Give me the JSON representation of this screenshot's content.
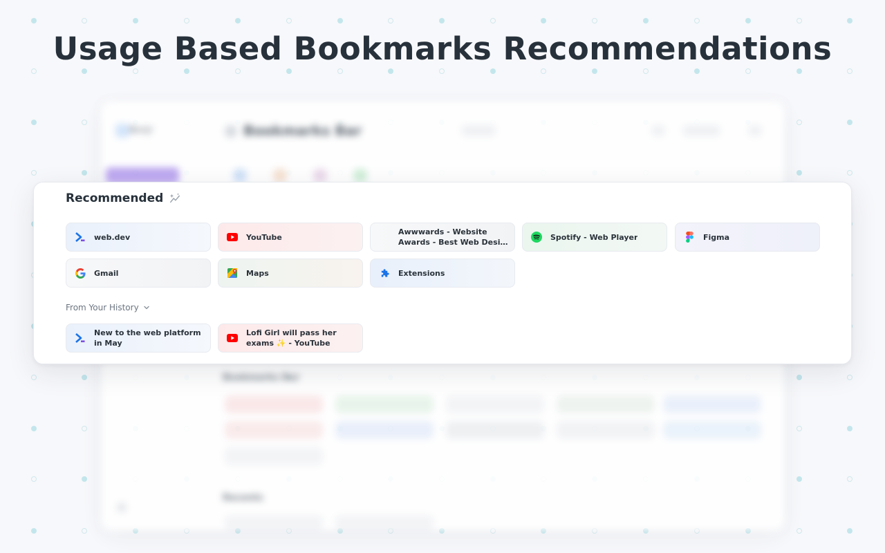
{
  "headline": "Usage Based Bookmarks Recommendations",
  "background_app": {
    "brand": "Bonjr",
    "title": "Bookmarks Bar",
    "section_label": "Bookmarks Bar",
    "section2_label": "Recents"
  },
  "recommended": {
    "title": "Recommended",
    "items": [
      {
        "label": "web.dev",
        "icon": "web-dev-icon"
      },
      {
        "label": "YouTube",
        "icon": "youtube-icon"
      },
      {
        "label": "Awwwards - Website Awards - Best Web Design Trends",
        "icon": "awwwards-icon"
      },
      {
        "label": "Spotify - Web Player",
        "icon": "spotify-icon"
      },
      {
        "label": "Figma",
        "icon": "figma-icon"
      },
      {
        "label": "Gmail",
        "icon": "google-icon"
      },
      {
        "label": "Maps",
        "icon": "google-maps-icon"
      },
      {
        "label": "Extensions",
        "icon": "puzzle-icon"
      }
    ]
  },
  "history": {
    "label": "From Your History",
    "items": [
      {
        "label": "New to the web platform in May",
        "icon": "web-dev-icon"
      },
      {
        "label": "Lofi Girl will pass her exams ✨ - YouTube",
        "icon": "youtube-icon"
      }
    ]
  },
  "colors": {
    "youtube": "#ff0000",
    "spotify": "#1ed760",
    "webdev": "#1a73e8",
    "title": "#27313b"
  }
}
